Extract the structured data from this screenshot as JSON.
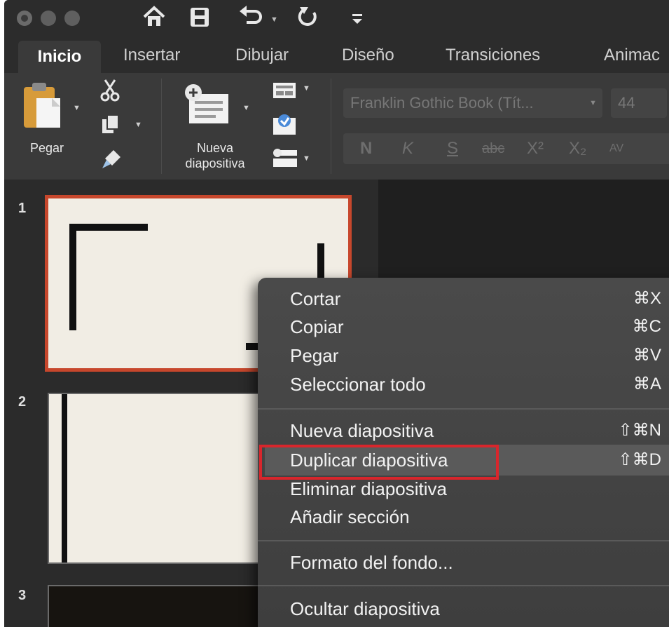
{
  "colors": {
    "chrome": "#2c2c2c",
    "ribbon": "#3a3a3a",
    "slide_panel": "#2b2b2b",
    "selected_slide_border": "#c7472c",
    "menu_bg": "#454545",
    "annotation_red": "#d8262c"
  },
  "tabs": [
    "Inicio",
    "Insertar",
    "Dibujar",
    "Diseño",
    "Transiciones",
    "Animac"
  ],
  "ribbon": {
    "paste_label": "Pegar",
    "new_slide_label_line1": "Nueva",
    "new_slide_label_line2": "diapositiva",
    "font_name": "Franklin Gothic Book (Tít...",
    "font_size": "44",
    "format_buttons": [
      "N",
      "K",
      "S",
      "abc",
      "X²",
      "X₂",
      "AV"
    ]
  },
  "slides": {
    "numbers": [
      "1",
      "2",
      "3"
    ],
    "selected": 1
  },
  "context_menu": {
    "items": [
      {
        "label": "Cortar",
        "shortcut": "⌘X"
      },
      {
        "label": "Copiar",
        "shortcut": "⌘C"
      },
      {
        "label": "Pegar",
        "shortcut": "⌘V"
      },
      {
        "label": "Seleccionar todo",
        "shortcut": "⌘A"
      },
      {
        "label": "Nueva diapositiva",
        "shortcut": "⇧⌘N"
      },
      {
        "label": "Duplicar diapositiva",
        "shortcut": "⇧⌘D",
        "highlighted": true
      },
      {
        "label": "Eliminar diapositiva",
        "shortcut": ""
      },
      {
        "label": "Añadir sección",
        "shortcut": ""
      },
      {
        "label": "Formato del fondo...",
        "shortcut": ""
      },
      {
        "label": "Ocultar diapositiva",
        "shortcut": ""
      }
    ]
  }
}
